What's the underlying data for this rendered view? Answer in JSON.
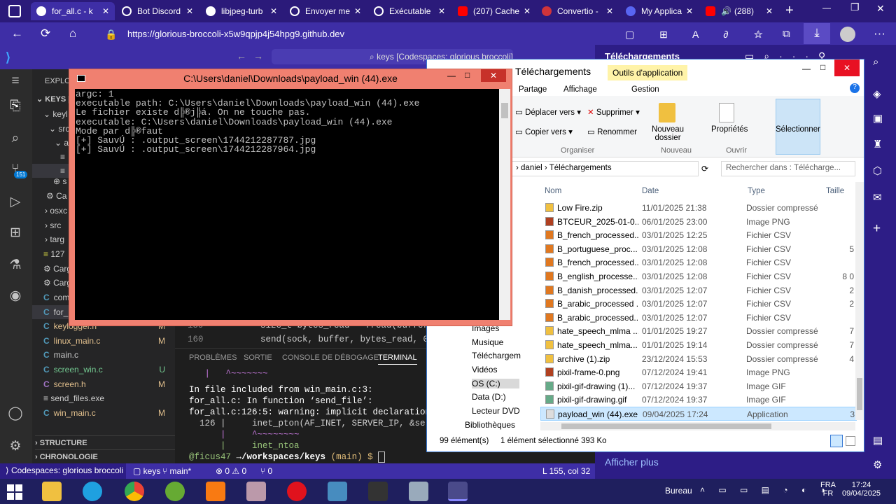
{
  "browser": {
    "tabs": [
      {
        "label": "for_all.c - k"
      },
      {
        "label": "Bot Discord"
      },
      {
        "label": "libjpeg-turb"
      },
      {
        "label": "Envoyer me"
      },
      {
        "label": "Exécutable"
      },
      {
        "label": "(207) Cache"
      },
      {
        "label": "Convertio -"
      },
      {
        "label": "My Applica"
      },
      {
        "label": "(288)"
      }
    ],
    "url": "https://glorious-broccoli-x5w9qpjp4j54hpg9.github.dev"
  },
  "vscode": {
    "search_text": "keys [Codespaces: glorious broccoli]",
    "explorer_title": "EXPLOR",
    "root": "KEYS [C",
    "badge": "151",
    "sidebar_items": [
      {
        "label": "keyl"
      },
      {
        "label": "src"
      },
      {
        "label": "a"
      },
      {
        "label": ""
      },
      {
        "label": ""
      },
      {
        "label": "s"
      },
      {
        "label": "Ca"
      },
      {
        "label": "osxc"
      },
      {
        "label": "src"
      },
      {
        "label": "targ"
      },
      {
        "label": "127"
      },
      {
        "label": "Carg"
      },
      {
        "label": "Carg"
      },
      {
        "label": "com"
      },
      {
        "label": "for_"
      },
      {
        "label": "keylogger.h",
        "flag": "M"
      },
      {
        "label": "linux_main.c",
        "flag": "M"
      },
      {
        "label": "main.c",
        "flag": ""
      },
      {
        "label": "screen_win.c",
        "flag": "U"
      },
      {
        "label": "screen.h",
        "flag": "M"
      },
      {
        "label": "send_files.exe",
        "flag": ""
      },
      {
        "label": "win_main.c",
        "flag": "M"
      }
    ],
    "sections": [
      "STRUCTURE",
      "CHRONOLOGIE"
    ],
    "editor_lines": [
      {
        "num": "159",
        "code": "size_t bytes_read = fread(buffer,"
      },
      {
        "num": "160",
        "code": "send(sock, buffer, bytes_read, 0)"
      }
    ],
    "panel_tabs": [
      "PROBLÈMES",
      "SORTIE",
      "CONSOLE DE DÉBOGAGE",
      "TERMINAL"
    ],
    "terminal_lines": [
      "   |   ^~~~~~~~",
      "In file included from win_main.c:3:",
      "for_all.c: In function ‘send_file’:",
      "for_all.c:126:5: warning: implicit declaration of fu",
      "  126 |     inet_pton(AF_INET, SERVER_IP, &server_ad",
      "      |     ^~~~~~~~~",
      "      |     inet_ntoa"
    ],
    "prompt_user": "@ficus47",
    "prompt_path": "→/workspaces/keys",
    "prompt_branch": "(main) $",
    "status": {
      "remote": "Codespaces: glorious broccoli",
      "repo": "keys",
      "branch": "main*",
      "problems": "⊗ 0 ⚠ 0",
      "ports": "⑂ 0",
      "position": "L 155, col 32"
    }
  },
  "cmd": {
    "title": "C:\\Users\\daniel\\Downloads\\payload_win (44).exe",
    "output": "argc: 1\nexecutable path: C:\\Users\\daniel\\Downloads\\payload_win (44).exe\nLe fichier existe d╠®j╠á. On ne touche pas.\nexecutable: C:\\Users\\daniel\\Downloads\\payload_win (44).exe\nMode par d╠®faut\n[+] SauvÚ : .output_screen\\1744212287787.jpg\n[+] SauvÚ : .output_screen\\1744212287964.jpg"
  },
  "downloads_panel": {
    "title": "Téléchargements",
    "more": "Afficher plus"
  },
  "explorer": {
    "title": "Téléchargements",
    "context_tab": "Outils d'application",
    "ribbon_tabs": [
      "Partage",
      "Affichage",
      "Gestion"
    ],
    "actions": {
      "move": "Déplacer vers",
      "copy": "Copier vers",
      "delete": "Supprimer",
      "rename": "Renommer",
      "new_folder": "Nouveau dossier",
      "properties": "Propriétés",
      "select": "Sélectionner"
    },
    "groups": [
      "Organiser",
      "Nouveau",
      "Ouvrir"
    ],
    "breadcrumb": [
      "daniel",
      "Téléchargements"
    ],
    "search_placeholder": "Rechercher dans : Télécharge...",
    "columns": [
      "Nom",
      "Date",
      "Type",
      "Taille"
    ],
    "nav": [
      "Images",
      "Musique",
      "Téléchargeme",
      "Vidéos",
      "OS (C:)",
      "Data (D:)",
      "Lecteur DVD R",
      "Bibliothèques"
    ],
    "files": [
      {
        "name": "Low Fire.zip",
        "date": "11/01/2025 21:38",
        "type": "Dossier compressé",
        "size": "",
        "icon": "zip"
      },
      {
        "name": "BTCEUR_2025-01-0...",
        "date": "06/01/2025 23:00",
        "type": "Image PNG",
        "size": "",
        "icon": "png"
      },
      {
        "name": "B_french_processed...",
        "date": "03/01/2025 12:25",
        "type": "Fichier CSV",
        "size": "",
        "icon": "csv"
      },
      {
        "name": "B_portuguese_proc...",
        "date": "03/01/2025 12:08",
        "type": "Fichier CSV",
        "size": "5",
        "icon": "csv"
      },
      {
        "name": "B_french_processed...",
        "date": "03/01/2025 12:08",
        "type": "Fichier CSV",
        "size": "",
        "icon": "csv"
      },
      {
        "name": "B_english_processe...",
        "date": "03/01/2025 12:08",
        "type": "Fichier CSV",
        "size": "8 0",
        "icon": "csv"
      },
      {
        "name": "B_danish_processed...",
        "date": "03/01/2025 12:07",
        "type": "Fichier CSV",
        "size": "2",
        "icon": "csv"
      },
      {
        "name": "B_arabic_processed ...",
        "date": "03/01/2025 12:07",
        "type": "Fichier CSV",
        "size": "2",
        "icon": "csv"
      },
      {
        "name": "B_arabic_processed...",
        "date": "03/01/2025 12:07",
        "type": "Fichier CSV",
        "size": "",
        "icon": "csv"
      },
      {
        "name": "hate_speech_mlma ...",
        "date": "01/01/2025 19:27",
        "type": "Dossier compressé",
        "size": "7",
        "icon": "zip"
      },
      {
        "name": "hate_speech_mlma...",
        "date": "01/01/2025 19:14",
        "type": "Dossier compressé",
        "size": "7",
        "icon": "zip"
      },
      {
        "name": "archive (1).zip",
        "date": "23/12/2024 15:53",
        "type": "Dossier compressé",
        "size": "4",
        "icon": "zip"
      },
      {
        "name": "pixil-frame-0.png",
        "date": "07/12/2024 19:41",
        "type": "Image PNG",
        "size": "",
        "icon": "png"
      },
      {
        "name": "pixil-gif-drawing (1)...",
        "date": "07/12/2024 19:37",
        "type": "Image GIF",
        "size": "",
        "icon": "gif"
      },
      {
        "name": "pixil-gif-drawing.gif",
        "date": "07/12/2024 19:37",
        "type": "Image GIF",
        "size": "",
        "icon": "gif"
      },
      {
        "name": "payload_win (44).exe",
        "date": "09/04/2025 17:24",
        "type": "Application",
        "size": "3",
        "icon": "exe"
      }
    ],
    "status_count": "99 élément(s)",
    "status_selected": "1 élément sélectionné  393 Ko"
  },
  "taskbar": {
    "desktop": "Bureau",
    "lang": "FRA",
    "lang2": "FR",
    "time": "17:24",
    "date": "09/04/2025"
  }
}
